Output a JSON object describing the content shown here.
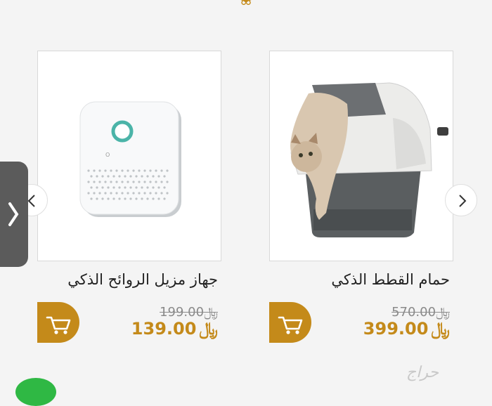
{
  "products": [
    {
      "title": "حمام القطط الذكي",
      "old_price": "570.00",
      "price": "399.00",
      "currency": "﷼",
      "image": "cat-litter-box-image",
      "cart_icon": "cart-icon"
    },
    {
      "title": "جهاز مزيل الروائح الذكي",
      "old_price": "199.00",
      "price": "139.00",
      "currency": "﷼",
      "image": "odor-remover-device-image",
      "cart_icon": "cart-icon"
    }
  ],
  "nav": {
    "next_icon": "chevron-right-icon",
    "prev_icon": "chevron-left-icon",
    "side_icon": "chevron-right-icon"
  },
  "watermark": "حراج",
  "colors": {
    "accent": "#c48a1a",
    "border": "#d8d8d8",
    "side_tab": "#5b5b5b",
    "whatsapp": "#2fb844"
  }
}
